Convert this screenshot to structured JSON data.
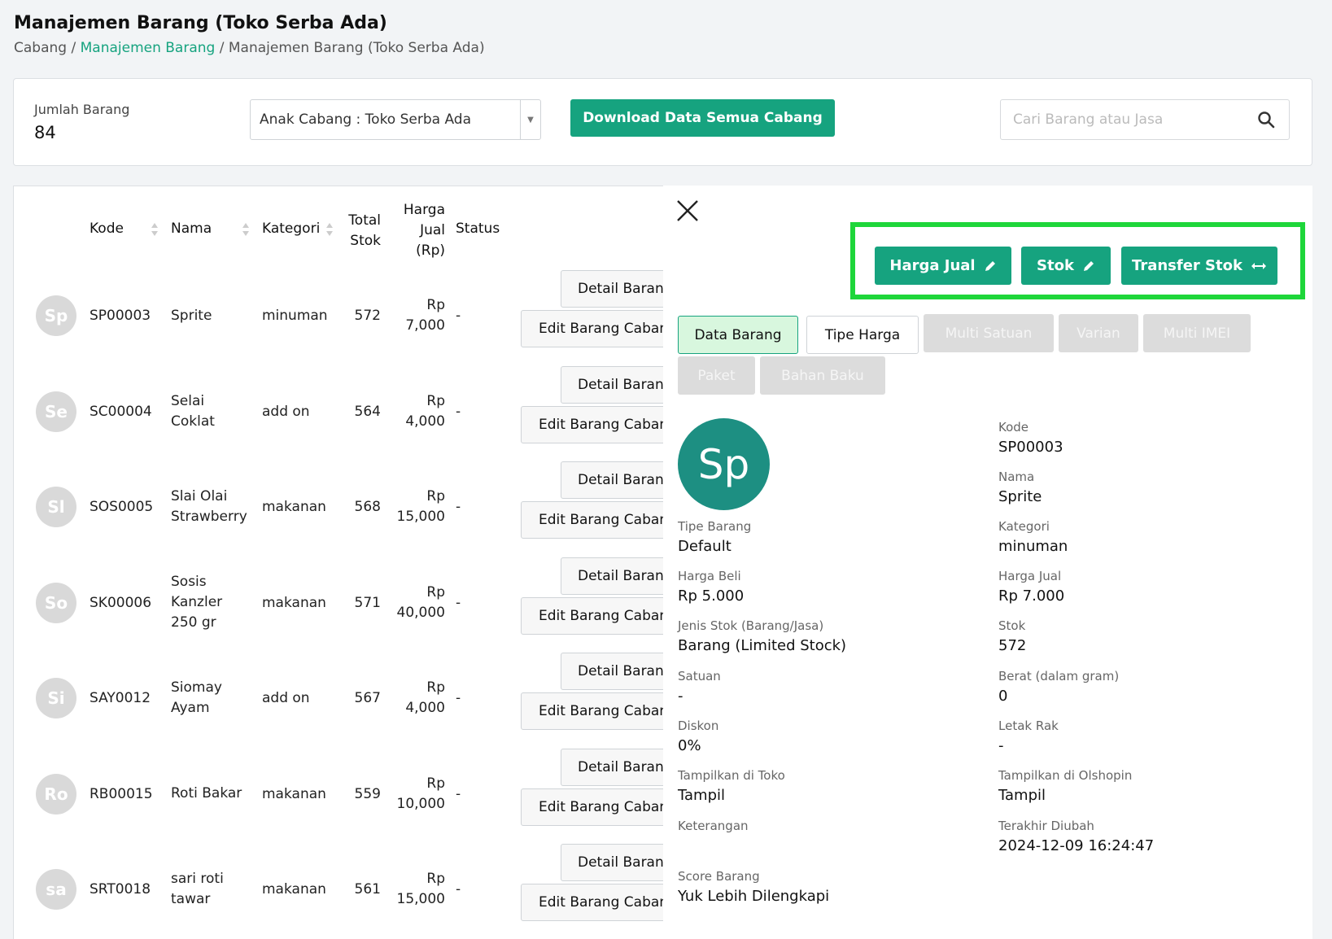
{
  "header": {
    "title": "Manajemen Barang (Toko Serba Ada)",
    "breadcrumb": {
      "root": "Cabang",
      "sep1": " / ",
      "link": "Manajemen Barang",
      "sep2": " / ",
      "current": "Manajemen Barang (Toko Serba Ada)"
    }
  },
  "toolbar": {
    "count_label": "Jumlah Barang",
    "count_value": "84",
    "branch_select": "Anak Cabang : Toko Serba Ada",
    "download_label": "Download Data Semua Cabang",
    "search_placeholder": "Cari Barang atau Jasa"
  },
  "table": {
    "headers": {
      "kode": "Kode",
      "nama": "Nama",
      "kategori": "Kategori",
      "total_stok_1": "Total",
      "total_stok_2": "Stok",
      "harga_1": "Harga",
      "harga_2": "Jual",
      "harga_3": "(Rp)",
      "status": "Status"
    },
    "detail_label": "Detail Barang",
    "edit_label": "Edit Barang Cabang",
    "rows": [
      {
        "initials": "Sp",
        "kode": "SP00003",
        "nama_lines": [
          "Sprite"
        ],
        "kategori": "minuman",
        "stok": "572",
        "harga_prefix": "Rp",
        "harga": "7,000",
        "status": "-"
      },
      {
        "initials": "Se",
        "kode": "SC00004",
        "nama_lines": [
          "Selai",
          "Coklat"
        ],
        "kategori": "add on",
        "stok": "564",
        "harga_prefix": "Rp",
        "harga": "4,000",
        "status": "-"
      },
      {
        "initials": "Sl",
        "kode": "SOS0005",
        "nama_lines": [
          "Slai Olai",
          "Strawberry"
        ],
        "kategori": "makanan",
        "stok": "568",
        "harga_prefix": "Rp",
        "harga": "15,000",
        "status": "-"
      },
      {
        "initials": "So",
        "kode": "SK00006",
        "nama_lines": [
          "Sosis",
          "Kanzler",
          "250 gr"
        ],
        "kategori": "makanan",
        "stok": "571",
        "harga_prefix": "Rp",
        "harga": "40,000",
        "status": "-"
      },
      {
        "initials": "Si",
        "kode": "SAY0012",
        "nama_lines": [
          "Siomay",
          "Ayam"
        ],
        "kategori": "add on",
        "stok": "567",
        "harga_prefix": "Rp",
        "harga": "4,000",
        "status": "-"
      },
      {
        "initials": "Ro",
        "kode": "RB00015",
        "nama_lines": [
          "Roti Bakar"
        ],
        "kategori": "makanan",
        "stok": "559",
        "harga_prefix": "Rp",
        "harga": "10,000",
        "status": "-"
      },
      {
        "initials": "sa",
        "kode": "SRT0018",
        "nama_lines": [
          "sari roti",
          "tawar"
        ],
        "kategori": "makanan",
        "stok": "561",
        "harga_prefix": "Rp",
        "harga": "15,000",
        "status": "-"
      }
    ]
  },
  "detail": {
    "actions": {
      "harga_jual": "Harga Jual",
      "stok": "Stok",
      "transfer_stok": "Transfer Stok"
    },
    "tabs": {
      "data_barang": "Data Barang",
      "tipe_harga": "Tipe Harga",
      "multi_satuan": "Multi Satuan",
      "varian": "Varian",
      "multi_imei": "Multi IMEI",
      "paket": "Paket",
      "bahan_baku": "Bahan Baku"
    },
    "avatar_initials": "Sp",
    "fields": {
      "kode_label": "Kode",
      "kode": "SP00003",
      "nama_label": "Nama",
      "nama": "Sprite",
      "tipe_label": "Tipe Barang",
      "tipe": "Default",
      "kategori_label": "Kategori",
      "kategori": "minuman",
      "harga_beli_label": "Harga Beli",
      "harga_beli": "Rp 5.000",
      "harga_jual_label": "Harga Jual",
      "harga_jual": "Rp 7.000",
      "jenis_stok_label": "Jenis Stok (Barang/Jasa)",
      "jenis_stok": "Barang (Limited Stock)",
      "stok_label": "Stok",
      "stok": "572",
      "satuan_label": "Satuan",
      "satuan": "-",
      "berat_label": "Berat (dalam gram)",
      "berat": "0",
      "diskon_label": "Diskon",
      "diskon": "0%",
      "letak_rak_label": "Letak Rak",
      "letak_rak": "-",
      "tampil_toko_label": "Tampilkan di Toko",
      "tampil_toko": "Tampil",
      "tampil_olshop_label": "Tampilkan di Olshopin",
      "tampil_olshop": "Tampil",
      "keterangan_label": "Keterangan",
      "terakhir_label": "Terakhir Diubah",
      "terakhir": "2024-12-09 16:24:47",
      "score_label": "Score Barang",
      "score": "Yuk Lebih Dilengkapi"
    }
  }
}
